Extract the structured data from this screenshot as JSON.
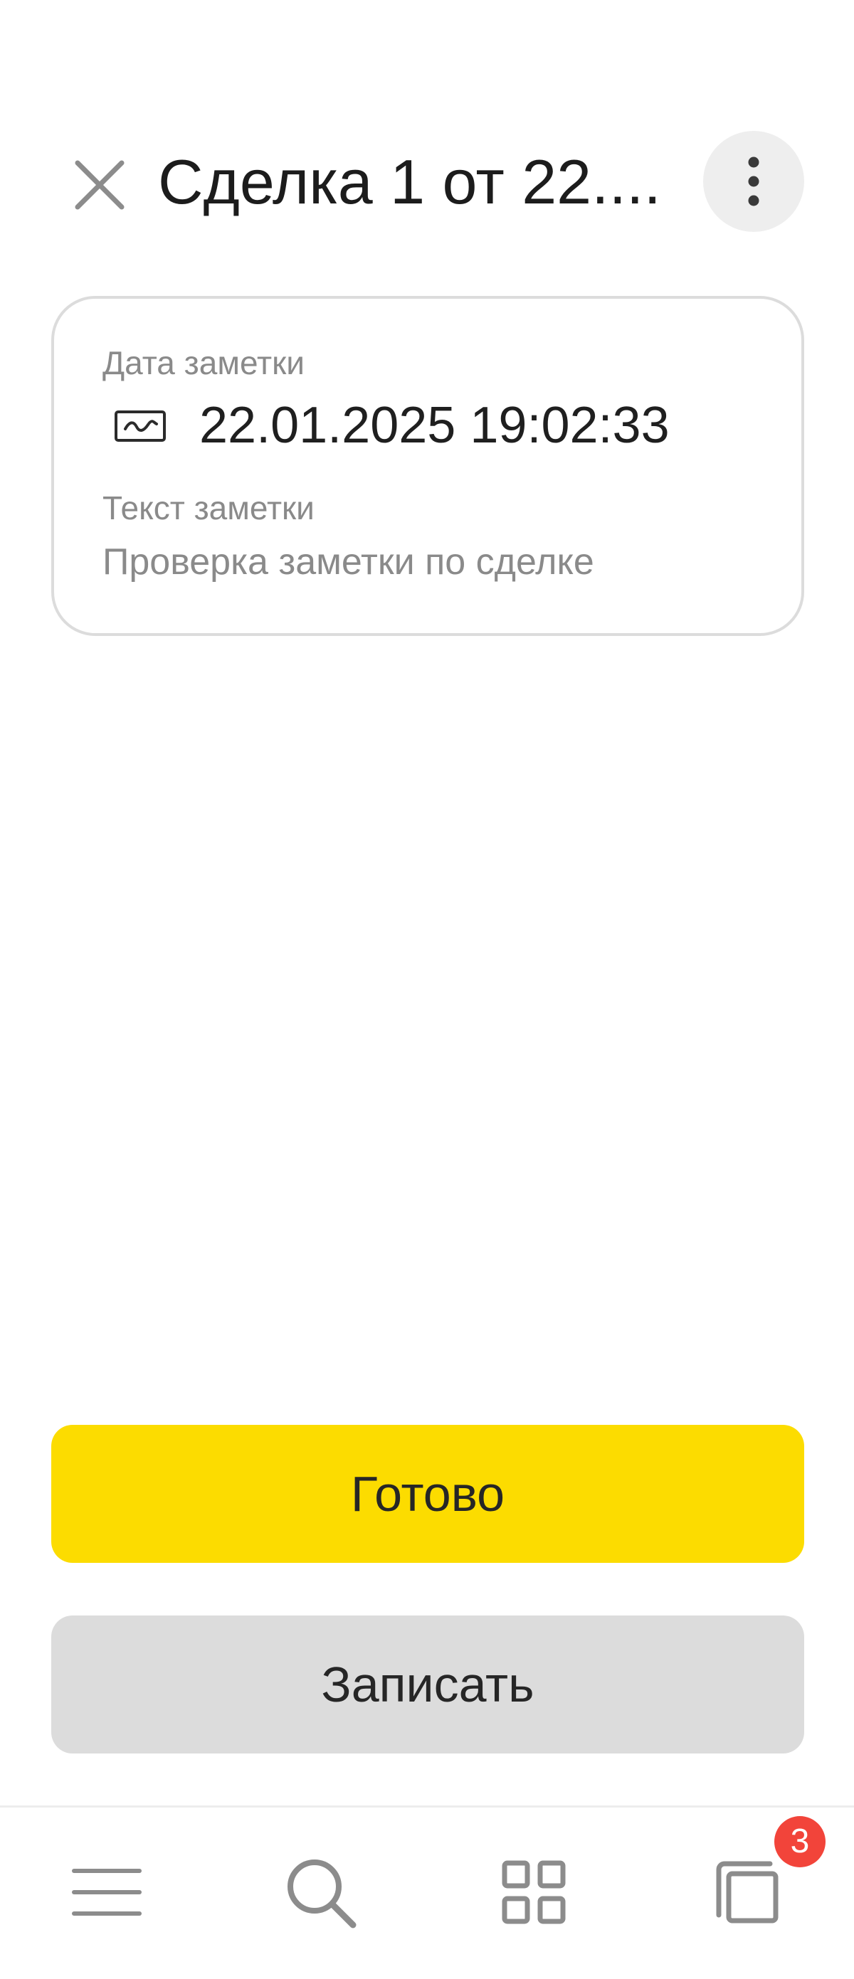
{
  "header": {
    "title": "Сделка 1 от 22....",
    "close_icon": "close-icon",
    "more_icon": "more-vertical-icon"
  },
  "card": {
    "date_label": "Дата заметки",
    "date_value": "22.01.2025 19:02:33",
    "date_icon": "signature-icon",
    "text_label": "Текст заметки",
    "text_value": "Проверка заметки по сделке"
  },
  "actions": {
    "done_label": "Готово",
    "save_label": "Записать"
  },
  "bottom_nav": {
    "items": [
      {
        "icon": "menu-icon"
      },
      {
        "icon": "search-icon"
      },
      {
        "icon": "apps-grid-icon"
      },
      {
        "icon": "windows-icon"
      }
    ],
    "windows_badge": "3"
  },
  "colors": {
    "accent": "#fcdc00",
    "secondary_button": "#dcdcdc",
    "badge": "#f2443a",
    "icon_gray": "#8c8c8c"
  }
}
